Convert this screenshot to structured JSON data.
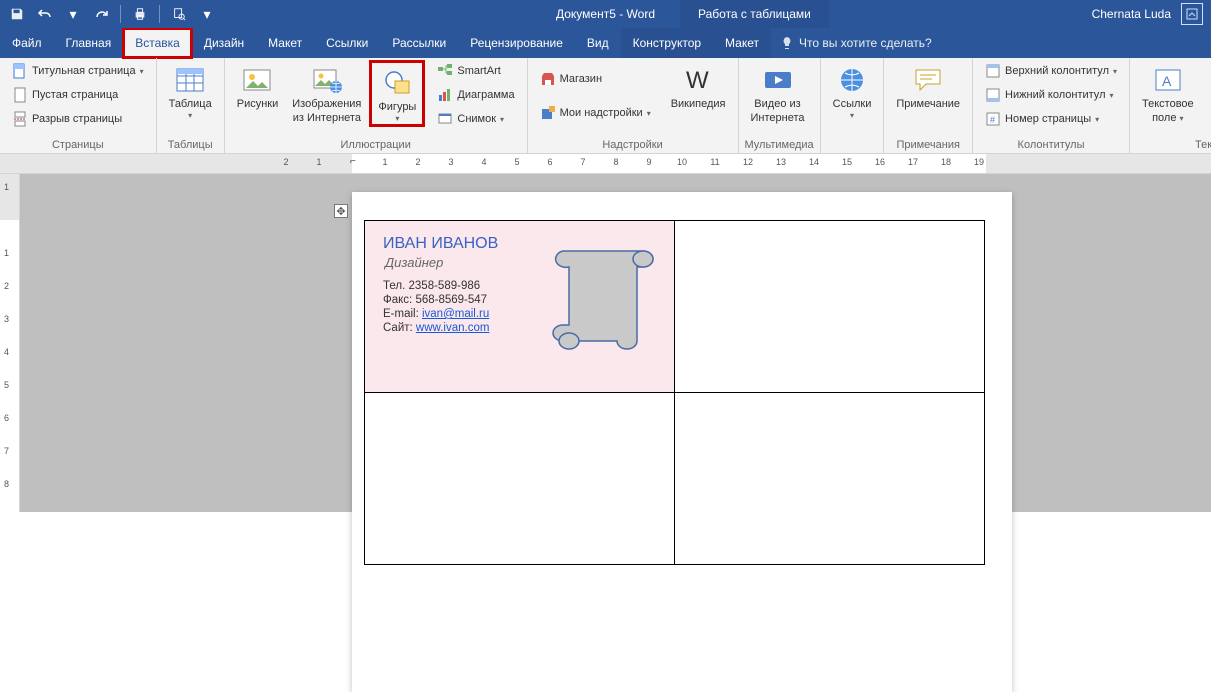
{
  "titlebar": {
    "doc_title": "Документ5 - Word",
    "table_tools": "Работа с таблицами",
    "user": "Chernata Luda"
  },
  "menu": {
    "file": "Файл",
    "home": "Главная",
    "insert": "Вставка",
    "design": "Дизайн",
    "layout": "Макет",
    "references": "Ссылки",
    "mailings": "Рассылки",
    "review": "Рецензирование",
    "view": "Вид",
    "constructor": "Конструктор",
    "layout2": "Макет",
    "tell_me": "Что вы хотите сделать?"
  },
  "ribbon": {
    "pages": {
      "cover": "Титульная страница",
      "blank": "Пустая страница",
      "break": "Разрыв страницы",
      "label": "Страницы"
    },
    "tables": {
      "table": "Таблица",
      "label": "Таблицы"
    },
    "illustrations": {
      "pictures": "Рисунки",
      "online_pictures_line1": "Изображения",
      "online_pictures_line2": "из Интернета",
      "shapes": "Фигуры",
      "smartart": "SmartArt",
      "chart": "Диаграмма",
      "screenshot": "Снимок",
      "label": "Иллюстрации"
    },
    "addins": {
      "store": "Магазин",
      "my_addins": "Мои надстройки",
      "wikipedia": "Википедия",
      "label": "Надстройки"
    },
    "media": {
      "online_video_line1": "Видео из",
      "online_video_line2": "Интернета",
      "label": "Мультимедиа"
    },
    "links": {
      "links": "Ссылки",
      "label": ""
    },
    "comments": {
      "comment": "Примечание",
      "label": "Примечания"
    },
    "header_footer": {
      "header": "Верхний колонтитул",
      "footer": "Нижний колонтитул",
      "page_no": "Номер страницы",
      "label": "Колонтитулы"
    },
    "text": {
      "textbox_line1": "Текстовое",
      "textbox_line2": "поле",
      "label": "Текст"
    }
  },
  "card": {
    "name": "ИВАН ИВАНОВ",
    "title": "Дизайнер",
    "tel_label": "Тел.",
    "tel": "2358-589-986",
    "fax_label": "Факс:",
    "fax": "568-8569-547",
    "email_label": "E-mail:",
    "email": "ivan@mail.ru",
    "site_label": "Сайт:",
    "site": "www.ivan.com"
  },
  "ruler": {
    "h_nums": [
      "2",
      "1",
      "1",
      "2",
      "3",
      "4",
      "5",
      "6",
      "7",
      "8",
      "9",
      "10",
      "11",
      "12",
      "13",
      "14",
      "15",
      "16",
      "17",
      "18",
      "19"
    ],
    "v_nums": [
      "1",
      "1",
      "2",
      "3",
      "4",
      "5",
      "6",
      "7"
    ]
  }
}
